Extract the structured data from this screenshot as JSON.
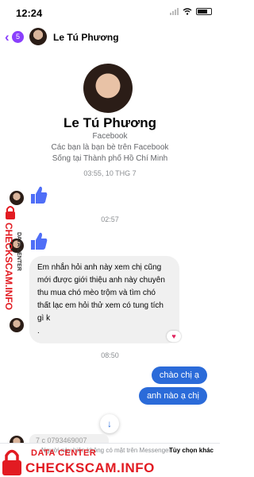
{
  "status_bar": {
    "time": "12:24"
  },
  "header": {
    "back_badge": "5",
    "contact_name": "Le Tú Phương"
  },
  "profile": {
    "name": "Le Tú Phương",
    "source": "Facebook",
    "friends_line": "Các bạn là bạn bè trên Facebook",
    "location_line": "Sống tại Thành phố Hồ Chí Minh"
  },
  "messages": {
    "ts1": "03:55, 10 THG 7",
    "ts2": "02:57",
    "incoming_text_lines": [
      "Em nhắn hỏi anh này xem chị cũng",
      "mới được giới thiệu anh này chuyên",
      "thu mua chó mèo trộm và tìm chó",
      "thất lạc em hỏi thử xem có tung tích",
      "gì k",
      "."
    ],
    "reaction": "♥",
    "ts3": "08:50",
    "outgoing_1": "chào chị ạ",
    "outgoing_2": "anh nào ạ chị",
    "partial_text": "7  c   0793469007"
  },
  "footer": {
    "notice": "Người này hiện không có mặt trên Messenger.",
    "options": "Tùy chọn khác"
  },
  "watermark": {
    "data_center": "DATA CENTER",
    "checkscam": "CHECKSCAM.INFO"
  },
  "colors": {
    "accent_purple": "#8a3ffc",
    "outgoing_blue": "#2b6bd9",
    "like_blue": "#4f6ef7",
    "watermark_red": "#e21b22"
  },
  "icons": [
    "back-chevron-icon",
    "like-thumb-icon",
    "arrow-down-icon",
    "heart-icon",
    "lock-icon",
    "battery-icon",
    "wifi-icon",
    "signal-icon"
  ]
}
